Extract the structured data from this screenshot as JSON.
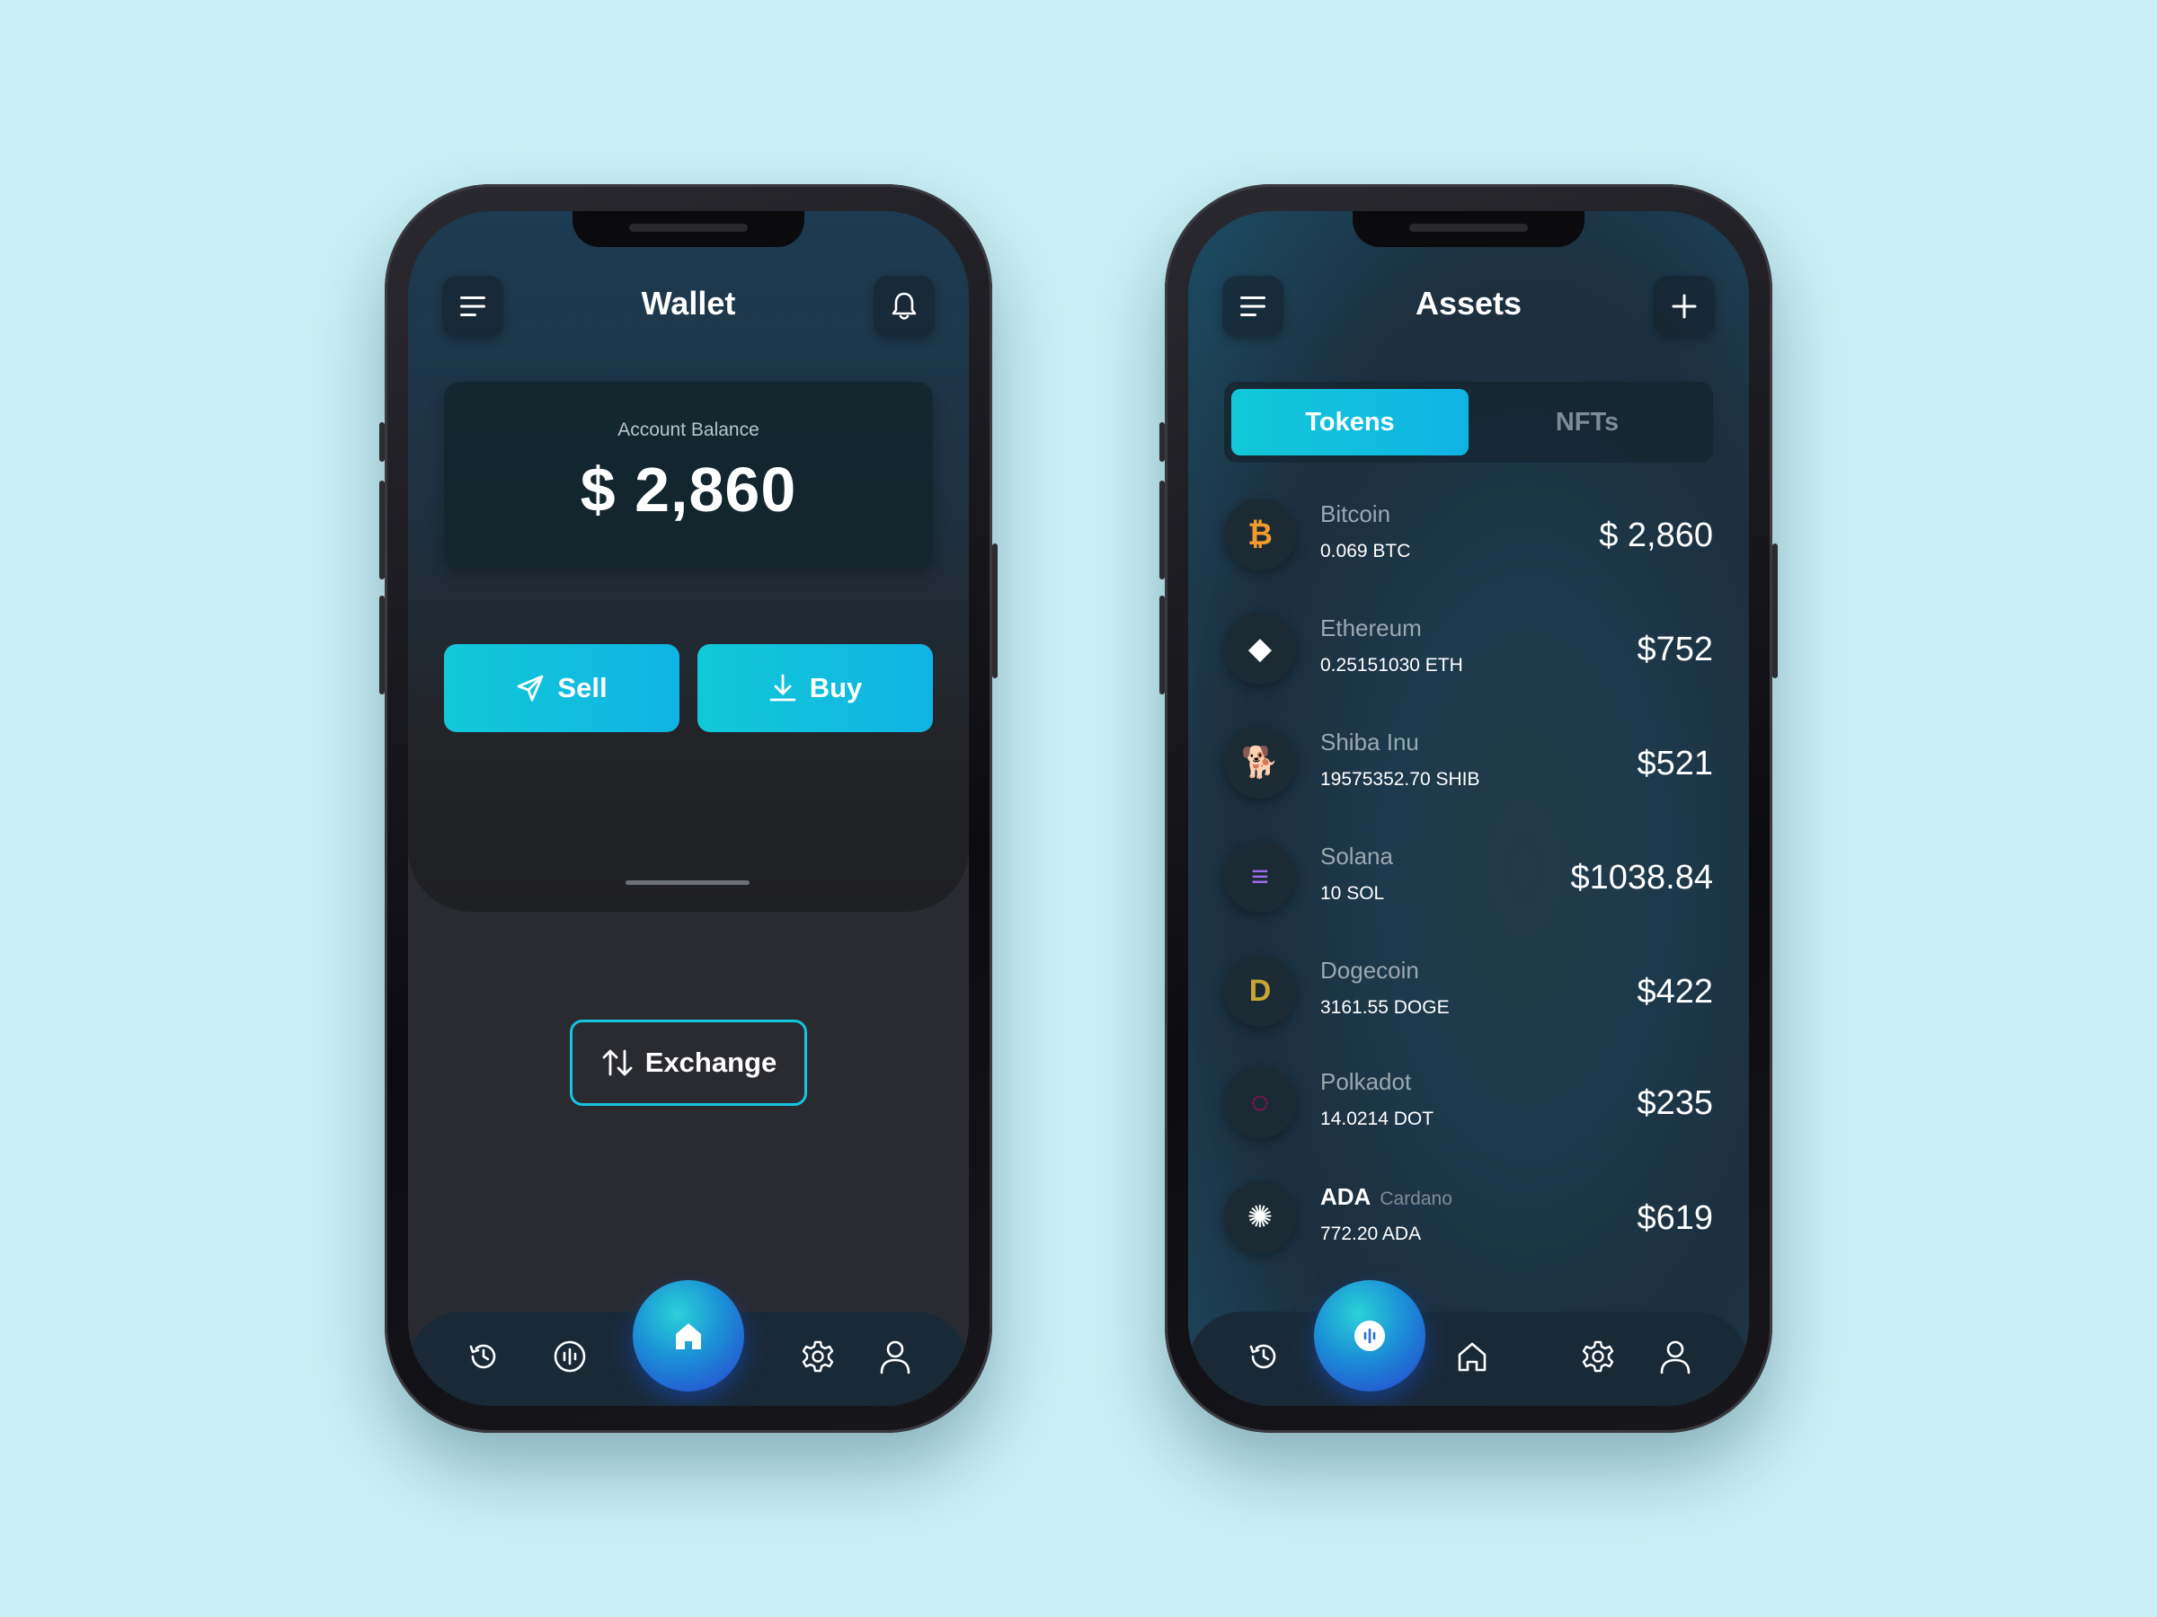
{
  "wallet": {
    "title": "Wallet",
    "balance_label": "Account Balance",
    "balance_value": "$ 2,860",
    "sell_label": "Sell",
    "buy_label": "Buy",
    "exchange_label": "Exchange",
    "nav": [
      "history-icon",
      "chart-icon",
      "home-icon",
      "settings-icon",
      "profile-icon"
    ]
  },
  "assets": {
    "title": "Assets",
    "tabs": {
      "active": "Tokens",
      "inactive": "NFTs"
    },
    "items": [
      {
        "name": "Bitcoin",
        "amount": "0.069 BTC",
        "value": "$ 2,860",
        "icon": "bitcoin-icon",
        "glyph": "₿",
        "color": "#f29a2e"
      },
      {
        "name": "Ethereum",
        "amount": "0.25151030 ETH",
        "value": "$752",
        "icon": "ethereum-icon",
        "glyph": "◆",
        "color": "#ffffff"
      },
      {
        "name": "Shiba Inu",
        "amount": "19575352.70 SHIB",
        "value": "$521",
        "icon": "shiba-inu-icon",
        "glyph": "🐕",
        "color": "#f0a030"
      },
      {
        "name": "Solana",
        "amount": "10 SOL",
        "value": "$1038.84",
        "icon": "solana-icon",
        "glyph": "≡",
        "color": "#9d6cf0"
      },
      {
        "name": "Dogecoin",
        "amount": "3161.55 DOGE",
        "value": "$422",
        "icon": "dogecoin-icon",
        "glyph": "D",
        "color": "#c8a633"
      },
      {
        "name": "Polkadot",
        "amount": "14.0214 DOT",
        "value": "$235",
        "icon": "polkadot-icon",
        "glyph": "◌",
        "color": "#e6007a"
      },
      {
        "name": "ADA",
        "subtitle": "Cardano",
        "amount": "772.20 ADA",
        "value": "$619",
        "icon": "cardano-icon",
        "glyph": "✺",
        "color": "#ffffff"
      }
    ],
    "nav": [
      "history-icon",
      "voice-icon",
      "home-icon",
      "settings-icon",
      "profile-icon"
    ]
  }
}
